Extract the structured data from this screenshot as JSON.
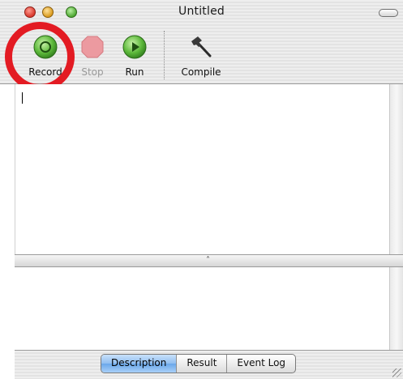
{
  "window": {
    "title": "Untitled"
  },
  "toolbar": {
    "record_label": "Record",
    "stop_label": "Stop",
    "run_label": "Run",
    "compile_label": "Compile"
  },
  "annotation": {
    "highlight_color": "#e31b23",
    "highlighted_item": "record-button"
  },
  "colors": {
    "record_green": "#5cb83a",
    "stop_disabled_red": "#e98a8f",
    "run_green": "#5cb83a",
    "selected_tab_blue": "#8fbdf0"
  },
  "splitter": {
    "grip_glyph": "˄"
  },
  "tabs": [
    {
      "label": "Description",
      "selected": true
    },
    {
      "label": "Result",
      "selected": false
    },
    {
      "label": "Event Log",
      "selected": false
    }
  ]
}
